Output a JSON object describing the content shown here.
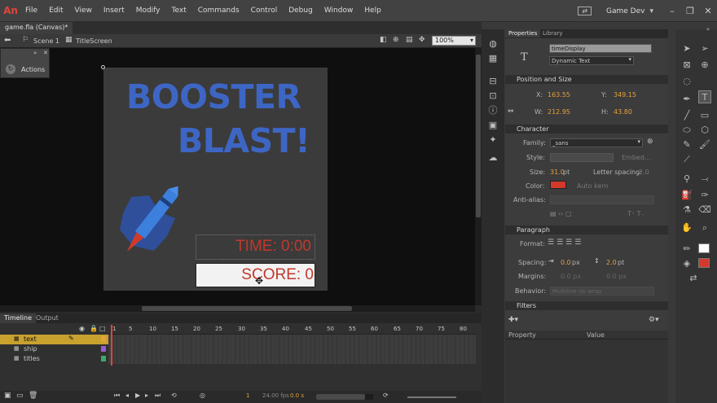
{
  "app": {
    "logo": "An"
  },
  "menu": [
    "File",
    "Edit",
    "View",
    "Insert",
    "Modify",
    "Text",
    "Commands",
    "Control",
    "Debug",
    "Window",
    "Help"
  ],
  "workspace": "Game Dev",
  "doc_tab": "game.fla (Canvas)*",
  "breadcrumb": {
    "scene": "Scene 1",
    "symbol": "TitleScreen"
  },
  "zoom": "100%",
  "actions_panel": "Actions",
  "stage": {
    "title_line1": "BOOSTER",
    "title_line2": "BLAST!",
    "time_text": "TIME: 0:00",
    "score_text": "SCORE: 0"
  },
  "timeline": {
    "tabs": [
      "Timeline",
      "Output"
    ],
    "frame_ticks": [
      "1",
      "5",
      "10",
      "15",
      "20",
      "25",
      "30",
      "35",
      "40",
      "45",
      "50",
      "55",
      "60",
      "65",
      "70",
      "75",
      "80"
    ],
    "layers": [
      "text",
      "ship",
      "titles"
    ],
    "current_frame": "1",
    "fps": "24.00 fps",
    "time": "0.0 s"
  },
  "properties": {
    "tabs": [
      "Properties",
      "Library"
    ],
    "instance_name": "timeDisplay",
    "text_type": "Dynamic Text",
    "position_size": {
      "header": "Position and Size",
      "x_label": "X:",
      "x": "163.55",
      "y_label": "Y:",
      "y": "349.15",
      "w_label": "W:",
      "w": "212.95",
      "h_label": "H:",
      "h": "43.80"
    },
    "character": {
      "header": "Character",
      "family_label": "Family:",
      "family": "_sans",
      "style_label": "Style:",
      "embed": "Embed...",
      "size_label": "Size:",
      "size": "31.0",
      "size_unit": "pt",
      "letter_spacing_label": "Letter spacing:",
      "letter_spacing": "2.0",
      "color_label": "Color:",
      "color": "#d33a2c",
      "auto_kern": "Auto kern",
      "anti_alias_label": "Anti-alias:"
    },
    "paragraph": {
      "header": "Paragraph",
      "format_label": "Format:",
      "spacing_label": "Spacing:",
      "indent": "0.0",
      "indent_unit": "px",
      "line_spacing": "2.0",
      "line_unit": "pt",
      "margins_label": "Margins:",
      "margin_left": "0.0 px",
      "margin_right": "0.0 px",
      "behavior_label": "Behavior:",
      "behavior": "Multiline no wrap"
    },
    "filters": {
      "header": "Filters",
      "col_property": "Property",
      "col_value": "Value"
    }
  },
  "colors": {
    "title_blue": "#3d66c4",
    "score_red": "#c0392b",
    "accent_orange": "#e6a13a"
  }
}
